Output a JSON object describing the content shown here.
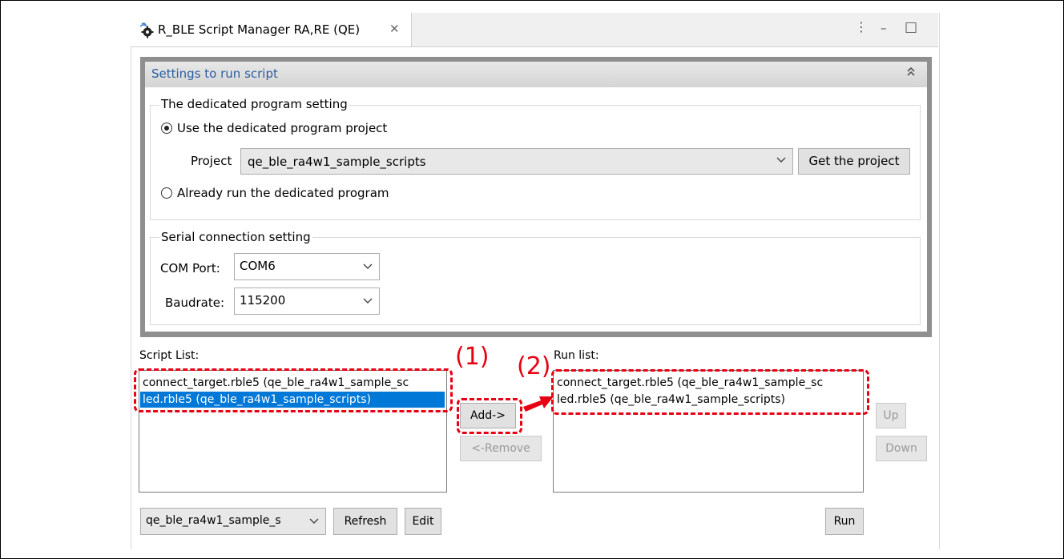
{
  "tab": {
    "title": "R_BLE Script Manager RA,RE (QE)",
    "close_glyph": "✕",
    "icon": "bluetooth-gear-icon"
  },
  "window_controls": {
    "view_menu": "⋮",
    "minimize": "–",
    "maximize": "□"
  },
  "section": {
    "title": "Settings to run script",
    "collapse_glyph": "⌃"
  },
  "dedicated_program": {
    "legend": "The dedicated program setting",
    "use_project_label": "Use the dedicated program project",
    "use_project_selected": true,
    "project_label": "Project",
    "project_value": "qe_ble_ra4w1_sample_scripts",
    "get_project_button": "Get the project",
    "already_run_label": "Already run the dedicated program",
    "already_run_selected": false
  },
  "serial": {
    "legend": "Serial connection setting",
    "com_port_label": "COM Port:",
    "com_port_value": "COM6",
    "baudrate_label": "Baudrate:",
    "baudrate_value": "115200"
  },
  "script_list": {
    "label": "Script List:",
    "items": [
      "connect_target.rble5 (qe_ble_ra4w1_sample_sc",
      "led.rble5 (qe_ble_ra4w1_sample_scripts)"
    ],
    "selected_index": 1
  },
  "run_list": {
    "label": "Run list:",
    "items": [
      "connect_target.rble5 (qe_ble_ra4w1_sample_sc",
      "led.rble5 (qe_ble_ra4w1_sample_scripts)"
    ]
  },
  "buttons": {
    "add": "Add->",
    "remove": "<-Remove",
    "up": "Up",
    "down": "Down",
    "refresh": "Refresh",
    "edit": "Edit",
    "run": "Run"
  },
  "project_filter": {
    "value": "qe_ble_ra4w1_sample_s"
  },
  "annotations": {
    "step1": "(1)",
    "step2": "(2)",
    "highlight_color": "#e60012"
  },
  "colors": {
    "selection": "#0078d7",
    "section_title": "#2b5e9e"
  }
}
